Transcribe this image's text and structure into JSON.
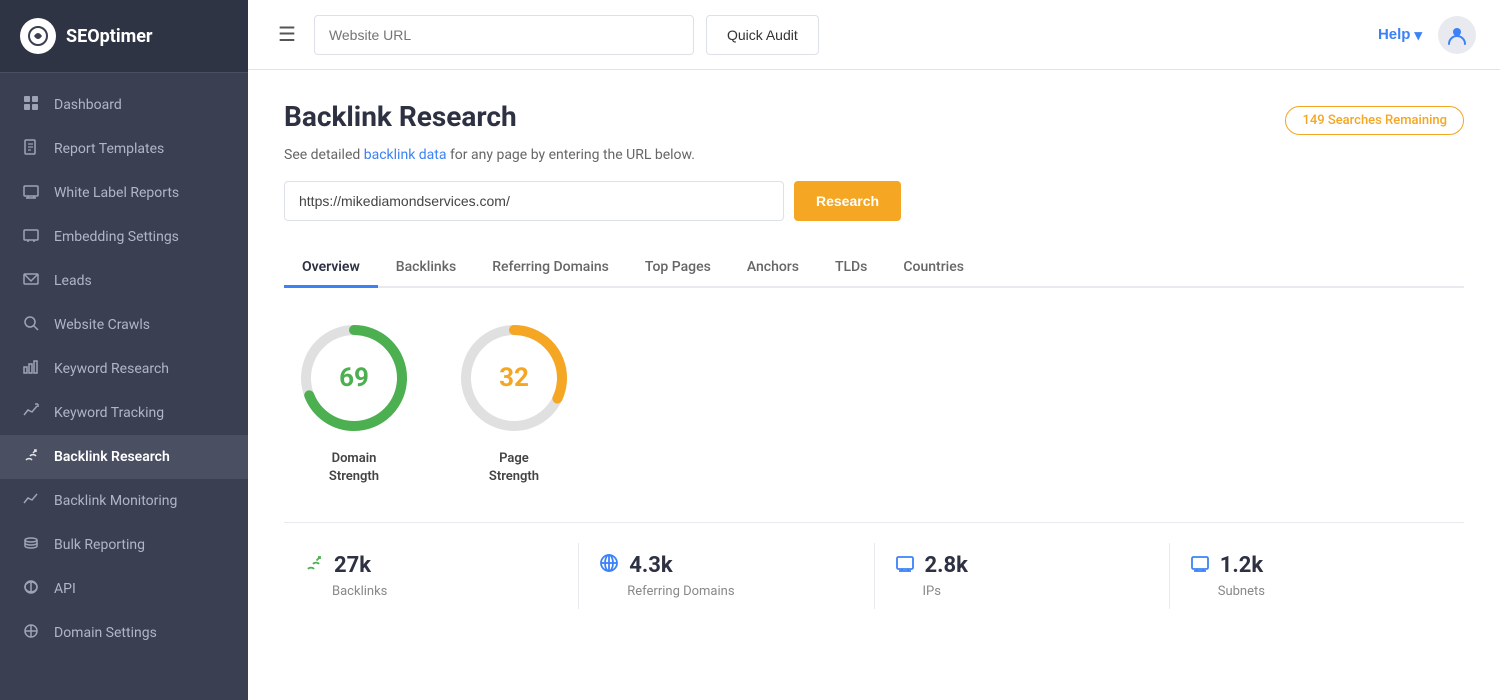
{
  "brand": {
    "logo_icon": "◎",
    "logo_text": "SEOptimer"
  },
  "sidebar": {
    "items": [
      {
        "id": "dashboard",
        "label": "Dashboard",
        "icon": "⊞",
        "active": false
      },
      {
        "id": "report-templates",
        "label": "Report Templates",
        "icon": "📄",
        "active": false
      },
      {
        "id": "white-label",
        "label": "White Label Reports",
        "icon": "🖥",
        "active": false
      },
      {
        "id": "embedding",
        "label": "Embedding Settings",
        "icon": "🖥",
        "active": false
      },
      {
        "id": "leads",
        "label": "Leads",
        "icon": "✉",
        "active": false
      },
      {
        "id": "website-crawls",
        "label": "Website Crawls",
        "icon": "🔍",
        "active": false
      },
      {
        "id": "keyword-research",
        "label": "Keyword Research",
        "icon": "📊",
        "active": false
      },
      {
        "id": "keyword-tracking",
        "label": "Keyword Tracking",
        "icon": "📌",
        "active": false
      },
      {
        "id": "backlink-research",
        "label": "Backlink Research",
        "icon": "🔗",
        "active": true
      },
      {
        "id": "backlink-monitoring",
        "label": "Backlink Monitoring",
        "icon": "📈",
        "active": false
      },
      {
        "id": "bulk-reporting",
        "label": "Bulk Reporting",
        "icon": "☁",
        "active": false
      },
      {
        "id": "api",
        "label": "API",
        "icon": "⚙",
        "active": false
      },
      {
        "id": "domain-settings",
        "label": "Domain Settings",
        "icon": "🌐",
        "active": false
      }
    ]
  },
  "topbar": {
    "url_placeholder": "Website URL",
    "quick_audit_label": "Quick Audit",
    "help_label": "Help",
    "help_chevron": "▾"
  },
  "page": {
    "title": "Backlink Research",
    "searches_remaining": "149 Searches Remaining",
    "subtitle_text": "See detailed backlink data for any page by entering the URL below.",
    "subtitle_link": "backlink data",
    "url_value": "https://mikediamondservices.com/",
    "research_btn": "Research"
  },
  "tabs": [
    {
      "id": "overview",
      "label": "Overview",
      "active": true
    },
    {
      "id": "backlinks",
      "label": "Backlinks",
      "active": false
    },
    {
      "id": "referring-domains",
      "label": "Referring Domains",
      "active": false
    },
    {
      "id": "top-pages",
      "label": "Top Pages",
      "active": false
    },
    {
      "id": "anchors",
      "label": "Anchors",
      "active": false
    },
    {
      "id": "tlds",
      "label": "TLDs",
      "active": false
    },
    {
      "id": "countries",
      "label": "Countries",
      "active": false
    }
  ],
  "charts": [
    {
      "id": "domain-strength",
      "value": 69,
      "max": 100,
      "color": "#4caf50",
      "track_color": "#e0e0e0",
      "label": "Domain\nStrength",
      "value_color": "#4caf50"
    },
    {
      "id": "page-strength",
      "value": 32,
      "max": 100,
      "color": "#f5a623",
      "track_color": "#e0e0e0",
      "label": "Page\nStrength",
      "value_color": "#f5a623"
    }
  ],
  "stats": [
    {
      "id": "backlinks",
      "icon": "🔗",
      "value": "27k",
      "label": "Backlinks",
      "icon_color": "#4caf50"
    },
    {
      "id": "referring-domains",
      "icon": "🌐",
      "value": "4.3k",
      "label": "Referring Domains",
      "icon_color": "#3b82f6"
    },
    {
      "id": "ips",
      "icon": "🖥",
      "value": "2.8k",
      "label": "IPs",
      "icon_color": "#3b82f6"
    },
    {
      "id": "subnets",
      "icon": "🖥",
      "value": "1.2k",
      "label": "Subnets",
      "icon_color": "#3b82f6"
    }
  ]
}
